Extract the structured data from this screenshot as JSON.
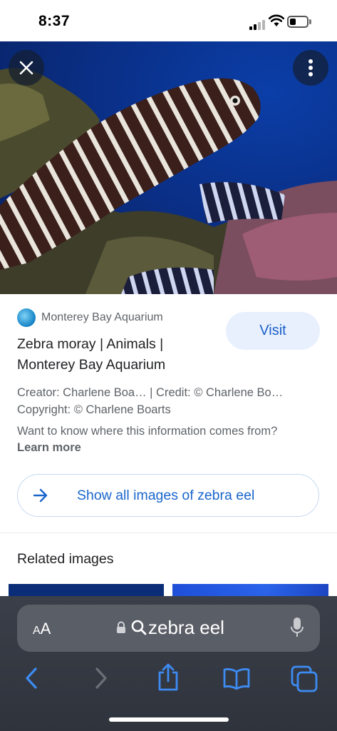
{
  "status_bar": {
    "time": "8:37"
  },
  "image_viewer": {
    "close_icon": "close-icon",
    "more_icon": "more-vert-icon"
  },
  "source": {
    "name": "Monterey Bay Aquarium",
    "visit_label": "Visit",
    "title_line1": "Zebra moray | Animals |",
    "title_line2": "Monterey Bay Aquarium",
    "creator_credit": "Creator: Charlene Boa… | Credit: © Charlene Bo…",
    "copyright": "Copyright: © Charlene Boarts",
    "info_question": "Want to know where this information comes from?",
    "learn_more": "Learn more"
  },
  "show_all": {
    "label": "Show all images of zebra eel"
  },
  "related": {
    "heading": "Related images"
  },
  "browser": {
    "aa_label_small": "A",
    "aa_label_big": "A",
    "url_text": "zebra eel"
  },
  "colors": {
    "accent": "#1a66cc",
    "visit_bg": "#e8f0fe",
    "toolbar_bg": "#3b3f49",
    "nav_blue": "#3d8bf2"
  }
}
